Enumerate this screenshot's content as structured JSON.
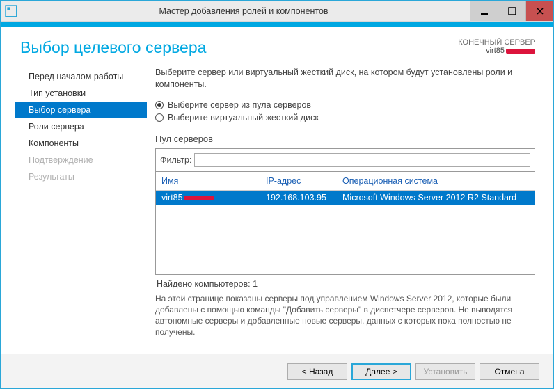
{
  "window_title": "Мастер добавления ролей и компонентов",
  "header": {
    "page_title": "Выбор целевого сервера",
    "badge_label": "КОНЕЧНЫЙ СЕРВЕР",
    "badge_server": "virt85"
  },
  "sidebar": {
    "items": [
      {
        "label": "Перед началом работы",
        "state": "normal"
      },
      {
        "label": "Тип установки",
        "state": "normal"
      },
      {
        "label": "Выбор сервера",
        "state": "active"
      },
      {
        "label": "Роли сервера",
        "state": "normal"
      },
      {
        "label": "Компоненты",
        "state": "normal"
      },
      {
        "label": "Подтверждение",
        "state": "disabled"
      },
      {
        "label": "Результаты",
        "state": "disabled"
      }
    ]
  },
  "main": {
    "instruction": "Выберите сервер или виртуальный жесткий диск, на котором будут установлены роли и компоненты.",
    "radio_pool": "Выберите сервер из пула серверов",
    "radio_vhd": "Выберите виртуальный жесткий диск",
    "pool_label": "Пул серверов",
    "filter_label": "Фильтр:",
    "filter_value": "",
    "columns": {
      "name": "Имя",
      "ip": "IP-адрес",
      "os": "Операционная система"
    },
    "rows": [
      {
        "name": "virt85",
        "ip": "192.168.103.95",
        "os": "Microsoft Windows Server 2012 R2 Standard"
      }
    ],
    "count_text": "Найдено компьютеров: 1",
    "note": "На этой странице показаны серверы под управлением Windows Server 2012, которые были добавлены с помощью команды \"Добавить серверы\" в диспетчере серверов. Не выводятся автономные серверы и добавленные новые серверы, данных с которых пока полностью не получены."
  },
  "footer": {
    "back": "< Назад",
    "next": "Далее >",
    "install": "Установить",
    "cancel": "Отмена"
  }
}
